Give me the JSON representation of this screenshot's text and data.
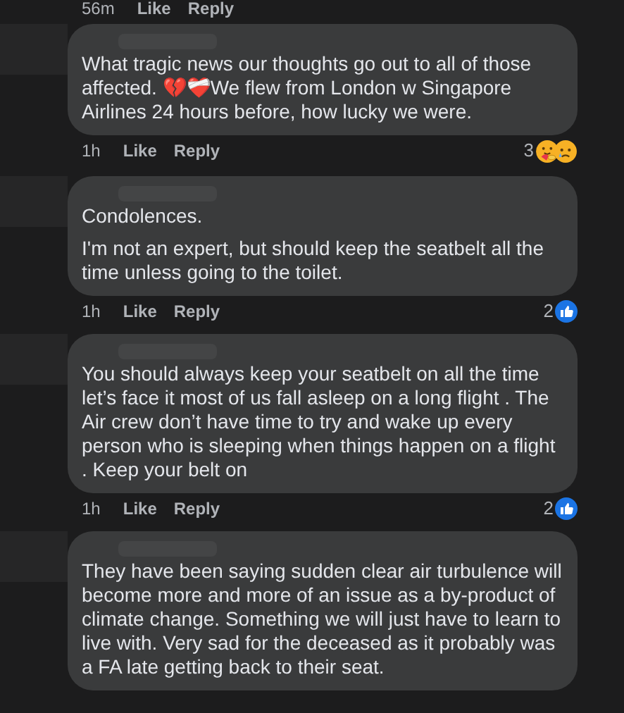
{
  "top_meta": {
    "time": "56m",
    "like": "Like",
    "reply": "Reply"
  },
  "comments": [
    {
      "paragraphs": [
        "What tragic news our thoughts go out to all of those affected. 💔❤️‍🩹We flew from London w Singapore Airlines 24 hours before, how lucky we were."
      ],
      "time": "1h",
      "like": "Like",
      "reply": "Reply",
      "reactions": {
        "count": "3",
        "icons": [
          {
            "kind": "care"
          },
          {
            "kind": "sad"
          }
        ]
      }
    },
    {
      "paragraphs": [
        "Condolences.",
        "I'm not an expert, but should keep the seatbelt all the time unless going to the toilet."
      ],
      "time": "1h",
      "like": "Like",
      "reply": "Reply",
      "reactions": {
        "count": "2",
        "icons": [
          {
            "kind": "like"
          }
        ]
      }
    },
    {
      "paragraphs": [
        "You should always keep your seatbelt on all the time let’s face it most of us fall asleep on a long flight . The Air crew don’t have time to try and wake up every person who is sleeping when things happen on a flight . Keep your belt on"
      ],
      "time": "1h",
      "like": "Like",
      "reply": "Reply",
      "reactions": {
        "count": "2",
        "icons": [
          {
            "kind": "like"
          }
        ]
      }
    },
    {
      "paragraphs": [
        "They have been saying sudden clear air turbulence will become more and more of an issue as a by-product of climate change. Something we will just have to learn to live with. Very sad for the deceased as it probably was a FA late getting back to their seat."
      ]
    }
  ]
}
